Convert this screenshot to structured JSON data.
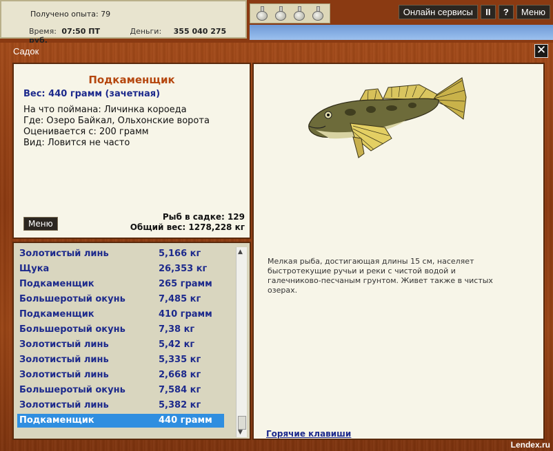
{
  "status": {
    "experience": "Получено опыта: 79",
    "time_label": "Время:",
    "time_value": "07:50 ПТ",
    "money_label": "Деньги:",
    "money_value": "355 040 275 руб."
  },
  "topbar": {
    "online_services": "Онлайн сервисы",
    "pause": "II",
    "help": "?",
    "menu": "Меню"
  },
  "window": {
    "title": "Садок",
    "close": "✕"
  },
  "fish_info": {
    "name": "Подкаменщик",
    "weight": "Вес: 440 грамм (зачетная)",
    "bait": "На что поймана: Личинка короеда",
    "location": "Где: Озеро Байкал, Ольхонские ворота",
    "valued_from": "Оценивается с: 200 грамм",
    "kind": "Вид: Ловится не часто",
    "menu_button": "Меню",
    "fish_count": "Рыб в садке: 129",
    "total_weight": "Общий вес: 1278,228 кг"
  },
  "catch_list": [
    {
      "name": "Золотистый линь",
      "weight": "5,166 кг"
    },
    {
      "name": "Щука",
      "weight": "26,353 кг"
    },
    {
      "name": "Подкаменщик",
      "weight": "265 грамм"
    },
    {
      "name": "Большеротый окунь",
      "weight": "7,485 кг"
    },
    {
      "name": "Подкаменщик",
      "weight": "410 грамм"
    },
    {
      "name": "Большеротый окунь",
      "weight": "7,38 кг"
    },
    {
      "name": "Золотистый линь",
      "weight": "5,42 кг"
    },
    {
      "name": "Золотистый линь",
      "weight": "5,335 кг"
    },
    {
      "name": "Золотистый линь",
      "weight": "2,668 кг"
    },
    {
      "name": "Большеротый окунь",
      "weight": "7,584 кг"
    },
    {
      "name": "Золотистый линь",
      "weight": "5,382 кг"
    },
    {
      "name": "Подкаменщик",
      "weight": "440 грамм"
    }
  ],
  "selected_index": 11,
  "description": {
    "text": "Мелкая рыба, достигающая длины 15 см, населяет быстротекущие ручьи и реки с чистой водой и галечниково-песчаным грунтом. Живет также в чистых озерах.",
    "hotkeys": "Горячие клавиши"
  },
  "watermark": "Lendex.ru"
}
